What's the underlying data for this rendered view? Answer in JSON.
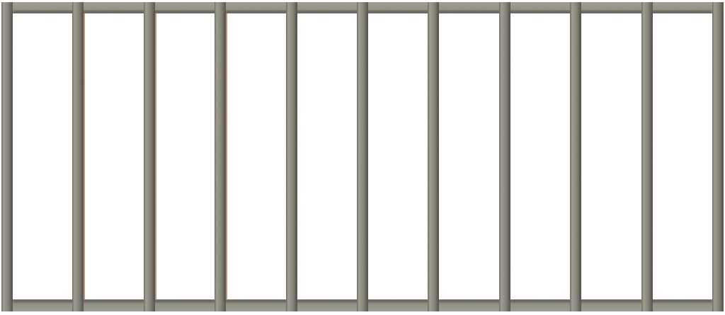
{
  "scene": {
    "subject": "metal-stud-wall-frame",
    "material": "galvanized-steel",
    "stud_count": 11,
    "bay_count": 10,
    "background_color": "#ffffff"
  },
  "colors": {
    "steel_light": "#a3a095",
    "steel_mid": "#8c8a80",
    "steel_dark": "#6f6d64",
    "steel_edge": "#5a5850",
    "plate_top": "#9a978c",
    "plate_bottom": "#96938a",
    "rust_tint": "#b27a52"
  },
  "rust_studs": [
    1,
    2,
    3
  ]
}
